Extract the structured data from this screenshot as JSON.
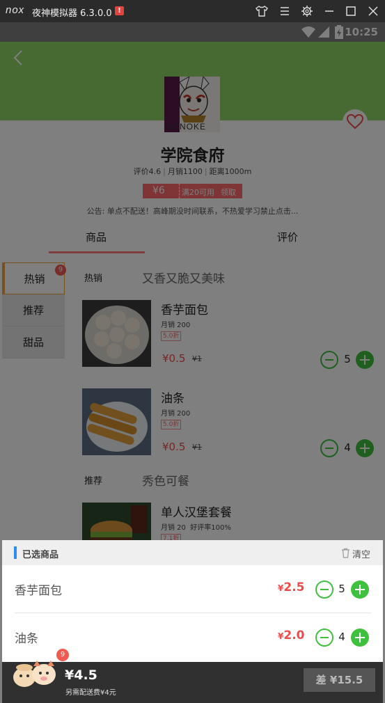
{
  "emulator": {
    "logo": "nox",
    "title": "夜神模拟器 6.3.0.0",
    "alert": "!",
    "buttons": [
      "shirt-icon",
      "menu-icon",
      "gear-icon",
      "minimize-icon",
      "maximize-icon",
      "close-icon"
    ]
  },
  "status_bar": {
    "time": "10:25",
    "icons": [
      "wifi-icon",
      "signal-icon",
      "battery-icon"
    ]
  },
  "shop": {
    "name": "学院食府",
    "logo_text": "NONOKE",
    "meta": [
      "评价4.6",
      "月销1100",
      "距离1000m"
    ],
    "coupon": {
      "amount": "¥6",
      "condition": "满20可用",
      "action": "领取"
    },
    "notice": "公告: 单点不配送！高峰期没时间联系，不热爱学习禁止点击..."
  },
  "tabs": [
    {
      "label": "商品",
      "active": true
    },
    {
      "label": "评价",
      "active": false
    }
  ],
  "categories": [
    {
      "label": "热销",
      "badge": "9",
      "active": true
    },
    {
      "label": "推荐"
    },
    {
      "label": "甜品"
    }
  ],
  "sections": [
    {
      "title": "热销",
      "subtitle": "又香又脆又美味"
    },
    {
      "title": "推荐",
      "subtitle": "秀色可餐"
    }
  ],
  "foods": [
    {
      "name": "香芋面包",
      "sales": "月销 200",
      "discount": "5.0折",
      "price": "¥0.5",
      "original": "¥1",
      "qty": "5"
    },
    {
      "name": "油条",
      "sales": "月销 200",
      "discount": "5.0折",
      "price": "¥0.5",
      "original": "¥1",
      "qty": "4"
    },
    {
      "name": "单人汉堡套餐",
      "sales": "月销 20",
      "rating": "好评率100%",
      "discount": "7.1折"
    }
  ],
  "cart": {
    "title": "已选商品",
    "clear_label": "清空",
    "items": [
      {
        "name": "香芋面包",
        "currency": "¥",
        "price": "2.5",
        "qty": "5"
      },
      {
        "name": "油条",
        "currency": "¥",
        "price": "2.0",
        "qty": "4"
      }
    ],
    "badge": "9",
    "total": "¥4.5",
    "delivery": "另需配送费¥4元",
    "checkout": "差 ¥15.5"
  },
  "colors": {
    "accent_green": "#3fc03f",
    "price_red": "#ef4b4b",
    "hero_green": "#8cd464",
    "coupon_red": "#ff6a6a"
  }
}
